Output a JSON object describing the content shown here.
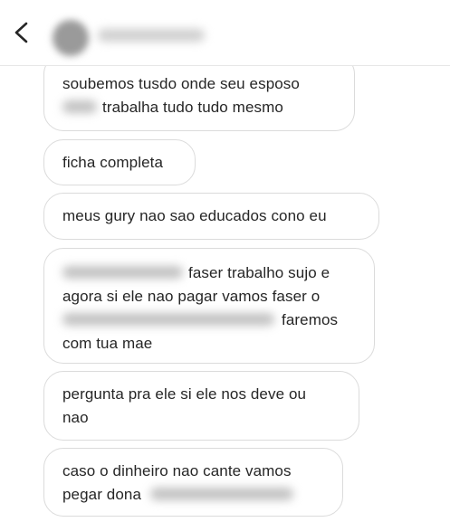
{
  "header": {
    "back_icon": "chevron-left-icon"
  },
  "messages": [
    {
      "lines": [
        [
          "soubemos tusdo onde seu esposo"
        ],
        [
          "trabalha tudo tudo mesmo"
        ]
      ]
    },
    {
      "lines": [
        [
          "ficha completa"
        ]
      ]
    },
    {
      "lines": [
        [
          "meus gury nao sao educados cono eu"
        ]
      ]
    },
    {
      "lines": [
        [
          "faser trabalho sujo e"
        ],
        [
          "agora si ele nao pagar vamos faser o"
        ],
        [
          "faremos"
        ],
        [
          "com tua mae"
        ]
      ]
    },
    {
      "lines": [
        [
          "pergunta pra ele si ele nos deve ou"
        ],
        [
          "nao"
        ]
      ]
    },
    {
      "lines": [
        [
          "caso o dinheiro nao cante vamos"
        ],
        [
          "pegar dona"
        ]
      ]
    }
  ],
  "colors": {
    "bubble_border": "#dbdbdb",
    "text": "#262626",
    "redaction": "#c2c2c2"
  }
}
